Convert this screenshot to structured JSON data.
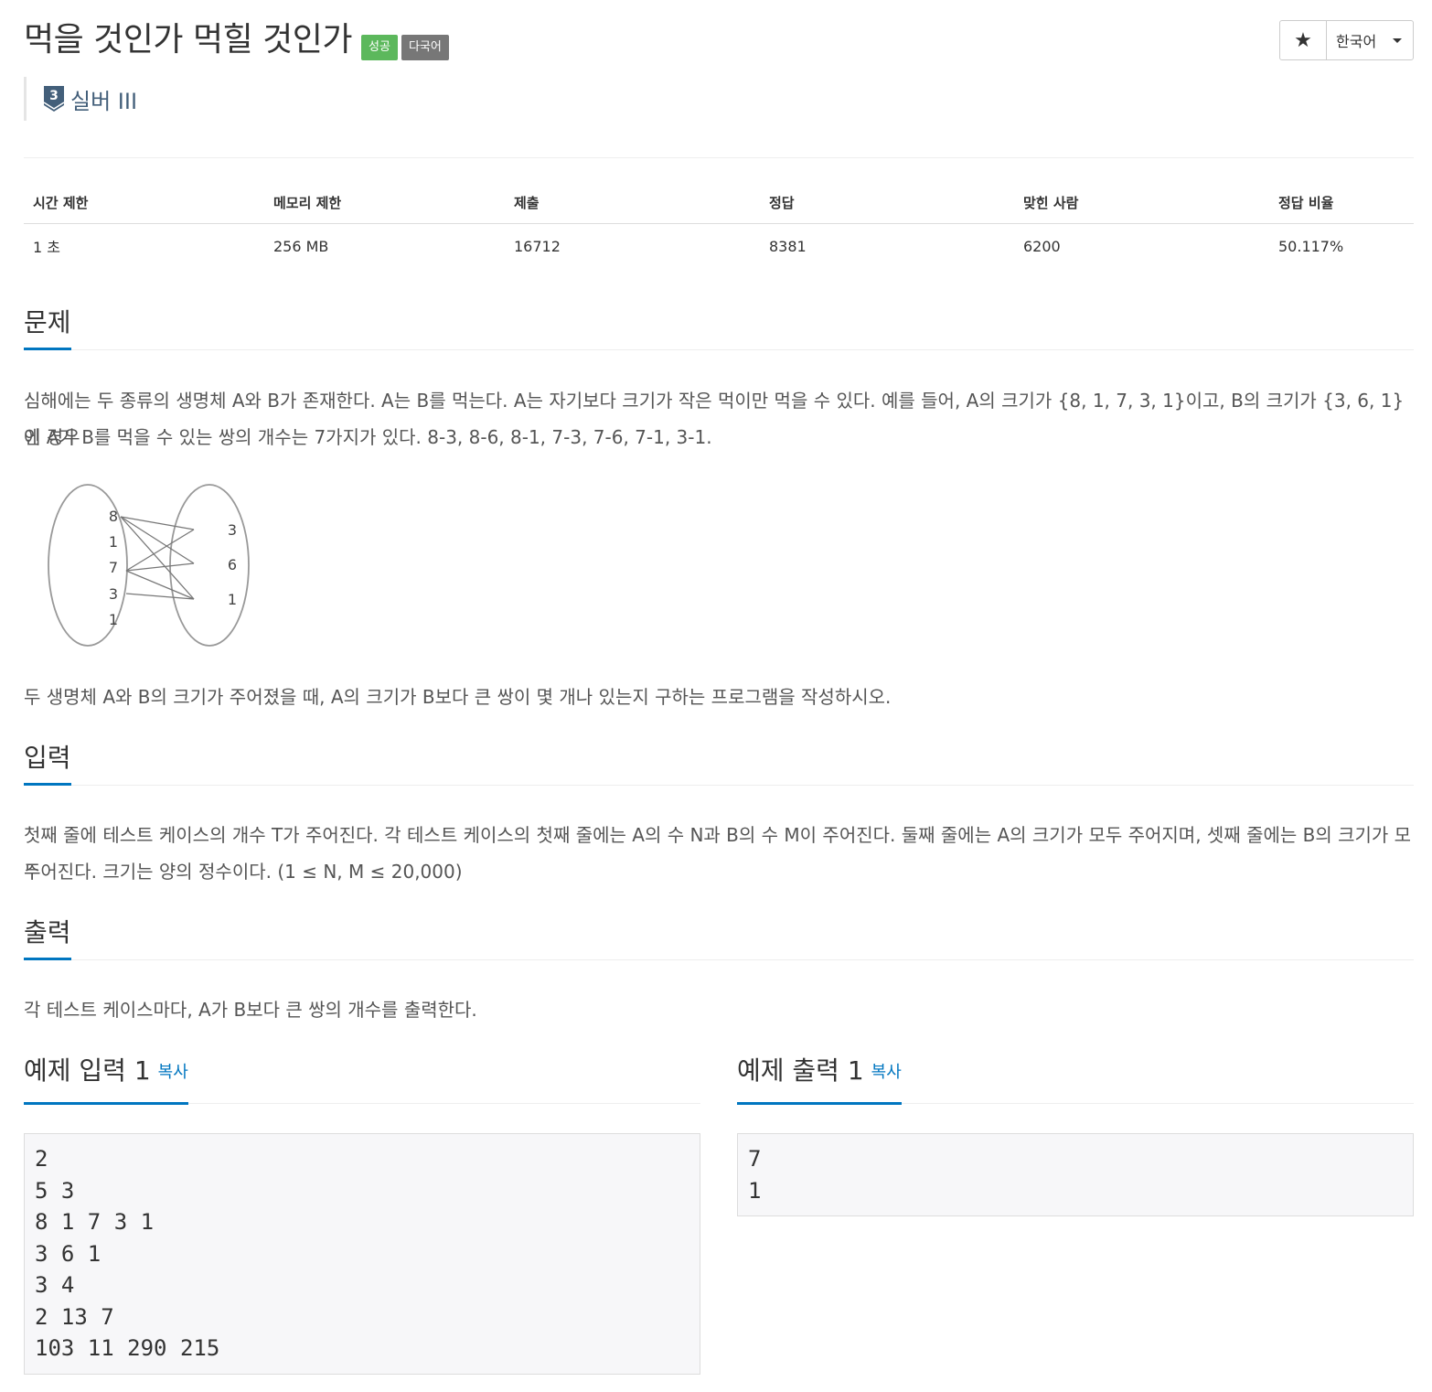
{
  "problem": {
    "title": "먹을 것인가 먹힐 것인가",
    "labels": {
      "success": "성공",
      "lang": "다국어"
    },
    "tier": {
      "number": "3",
      "name": "실버 III"
    }
  },
  "toolbar": {
    "star": "★",
    "language": "한국어"
  },
  "info_table": {
    "headers": [
      "시간 제한",
      "메모리 제한",
      "제출",
      "정답",
      "맞힌 사람",
      "정답 비율"
    ],
    "values": [
      "1 초",
      "256 MB",
      "16712",
      "8381",
      "6200",
      "50.117%"
    ]
  },
  "sections": {
    "description": {
      "title": "문제",
      "para1_line1": "심해에는 두 종류의 생명체 A와 B가 존재한다. A는 B를 먹는다. A는 자기보다 크기가 작은 먹이만 먹을 수 있다. 예를 들어, A의 크기가 {8, 1, 7, 3, 1}이고, B의 크기가 {3, 6, 1}인 경우",
      "para1_line2": "에 A가 B를 먹을 수 있는 쌍의 개수는 7가지가 있다. 8-3, 8-6, 8-1, 7-3, 7-6, 7-1, 3-1.",
      "para2": "두 생명체 A와 B의 크기가 주어졌을 때, A의 크기가 B보다 큰 쌍이 몇 개나 있는지 구하는 프로그램을 작성하시오."
    },
    "input": {
      "title": "입력",
      "line1": "첫째 줄에 테스트 케이스의 개수 T가 주어진다. 각 테스트 케이스의 첫째 줄에는 A의 수 N과 B의 수 M이 주어진다. 둘째 줄에는 A의 크기가 모두 주어지며, 셋째 줄에는 B의 크기가 모두",
      "line2": "주어진다. 크기는 양의 정수이다. (1 ≤ N, M ≤ 20,000)"
    },
    "output": {
      "title": "출력",
      "text": "각 테스트 케이스마다, A가 B보다 큰 쌍의 개수를 출력한다."
    }
  },
  "figure": {
    "set_a": [
      "8",
      "1",
      "7",
      "3",
      "1"
    ],
    "set_b": [
      "3",
      "6",
      "1"
    ]
  },
  "samples": {
    "input": {
      "title": "예제 입력 1",
      "copy": "복사",
      "content": "2\n5 3\n8 1 7 3 1\n3 6 1\n3 4\n2 13 7\n103 11 290 215"
    },
    "output": {
      "title": "예제 출력 1",
      "copy": "복사",
      "content": "7\n1"
    }
  }
}
